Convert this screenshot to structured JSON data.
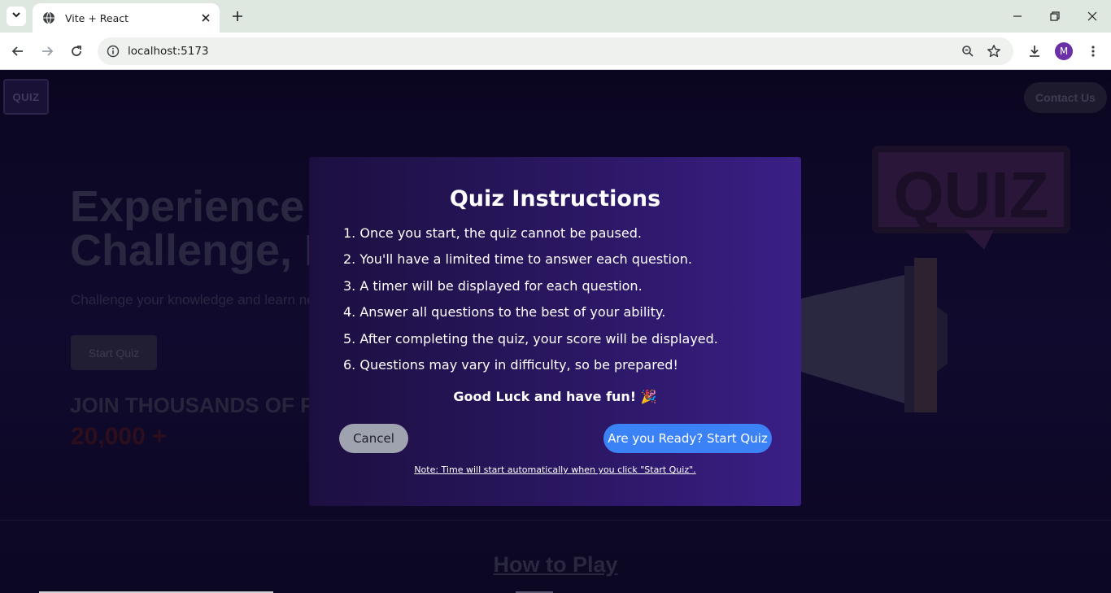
{
  "browser": {
    "tab_title": "Vite + React",
    "url": "localhost:5173",
    "profile_initial": "M",
    "icons": {
      "tab_menu": "chevron-down-icon",
      "favicon": "globe-icon",
      "tab_close": "close-icon",
      "new_tab": "plus-icon",
      "minimize": "minimize-icon",
      "restore": "restore-icon",
      "close_window": "close-icon",
      "back": "back-arrow-icon",
      "forward": "forward-arrow-icon",
      "reload": "reload-icon",
      "site_info": "info-icon",
      "zoom": "zoom-icon",
      "bookmark": "star-icon",
      "downloads": "download-icon",
      "menu": "kebab-menu-icon"
    }
  },
  "page": {
    "logo_text": "QUIZ",
    "contact_label": "Contact Us",
    "hero_line1": "Experience t",
    "hero_line2": "Challenge, F",
    "hero_subtitle": "Challenge your knowledge and learn ne",
    "hero_button": "Start Quiz",
    "join_text": "JOIN THOUSANDS OF P",
    "count_text": "20,000 +",
    "how_to_play": "How to Play",
    "illustration_text": "QUIZ"
  },
  "modal": {
    "title": "Quiz Instructions",
    "rules": [
      "1. Once you start, the quiz cannot be paused.",
      "2. You'll have a limited time to answer each question.",
      "3. A timer will be displayed for each question.",
      "4. Answer all questions to the best of your ability.",
      "5. After completing the quiz, your score will be displayed.",
      "6. Questions may vary in difficulty, so be prepared!"
    ],
    "good_luck": "Good Luck and have fun! 🎉",
    "cancel_label": "Cancel",
    "start_label": "Are you Ready? Start Quiz",
    "note": "Note: Time will start automatically when you click \"Start Quiz\"."
  },
  "colors": {
    "modal_gradient_start": "#1c0f40",
    "modal_gradient_end": "#3a1f86",
    "start_button": "#3b82f6",
    "cancel_button": "#9fa3b0"
  }
}
